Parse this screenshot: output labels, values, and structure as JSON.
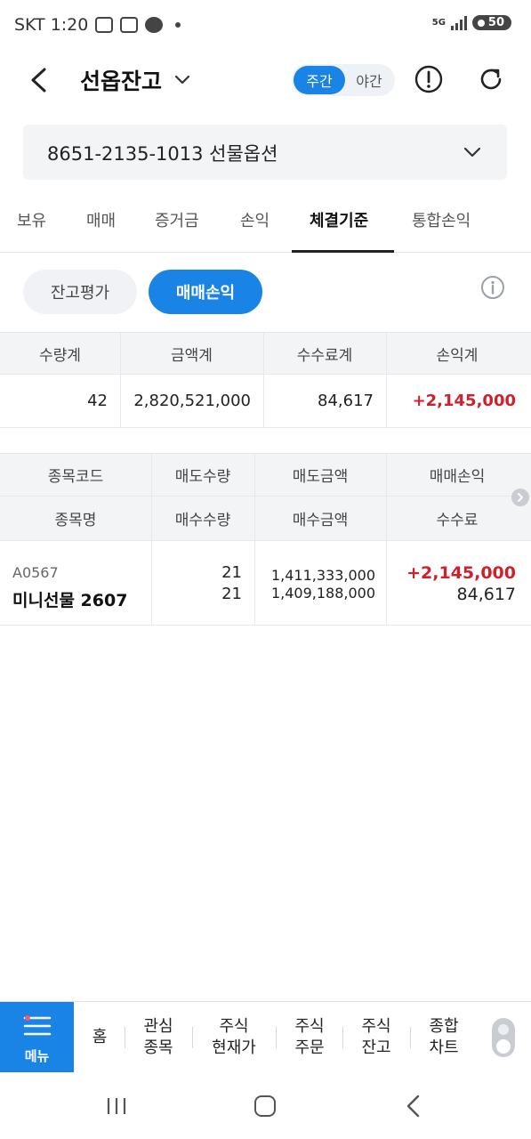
{
  "status_bar": {
    "carrier_time": "SKT 1:20",
    "network": "5G",
    "battery": "50"
  },
  "header": {
    "title": "선옵잔고",
    "toggle_day": "주간",
    "toggle_night": "야간"
  },
  "account": {
    "label": "8651-2135-1013 선물옵션"
  },
  "tabs": [
    "보유",
    "매매",
    "증거금",
    "손익",
    "체결기준",
    "통합손익"
  ],
  "chips": {
    "eval": "잔고평가",
    "pnl": "매매손익"
  },
  "summary": {
    "headers": [
      "수량계",
      "금액계",
      "수수료계",
      "손익계"
    ],
    "values": [
      "42",
      "2,820,521,000",
      "84,617",
      "+2,145,000"
    ]
  },
  "detail": {
    "headers_top": [
      "종목코드",
      "매도수량",
      "매도금액",
      "매매손익"
    ],
    "headers_bottom": [
      "종목명",
      "매수수량",
      "매수금액",
      "수수료"
    ],
    "row": {
      "code": "A0567",
      "name": "미니선물 2607",
      "sell_qty": "21",
      "buy_qty": "21",
      "sell_amt": "1,411,333,000",
      "buy_amt": "1,409,188,000",
      "pnl": "+2,145,000",
      "fee": "84,617"
    }
  },
  "bottom_nav": {
    "menu": "메뉴",
    "items": [
      {
        "line1": "홈",
        "line2": ""
      },
      {
        "line1": "관심",
        "line2": "종목"
      },
      {
        "line1": "주식",
        "line2": "현재가"
      },
      {
        "line1": "주식",
        "line2": "주문"
      },
      {
        "line1": "주식",
        "line2": "잔고"
      },
      {
        "line1": "종합",
        "line2": "차트"
      }
    ]
  },
  "colors": {
    "accent": "#1a84e6",
    "profit": "#d0202a"
  }
}
